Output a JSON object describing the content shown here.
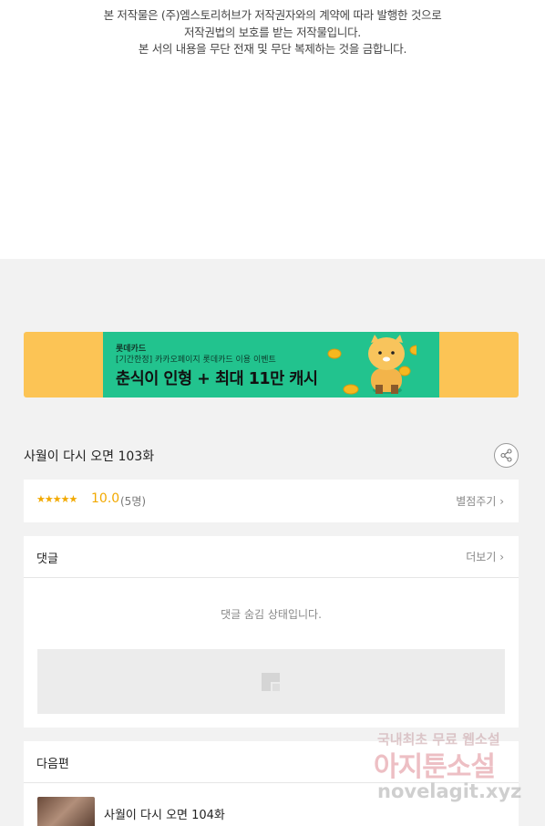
{
  "copyright": {
    "line1": "본 저작물은 (주)엠스토리허브가 저작권자와의 계약에 따라 발행한 것으로",
    "line2": "저작권법의 보호를 받는 저작물입니다.",
    "line3": "본 서의 내용을 무단 전재 및 무단 복제하는 것을 금합니다."
  },
  "banner": {
    "brand": "롯데카드",
    "subtitle": "[기간한정] 카카오페이지 롯데카드 이용 이벤트",
    "headline": "춘식이 인형 + 최대 11만 캐시",
    "colors": {
      "outer": "#fcc455",
      "inner": "#22c38e"
    }
  },
  "episode": {
    "title": "사월이 다시 오면 103화",
    "share_icon": "share-icon"
  },
  "rating": {
    "stars": "★★★★★",
    "score": "10.0",
    "count": "(5명)",
    "rate_link": "별점주기 ›"
  },
  "comments": {
    "label": "댓글",
    "more": "더보기 ›",
    "hidden_message": "댓글 숨김 상태입니다."
  },
  "next": {
    "label": "다음편",
    "title": "사월이 다시 오면 104화"
  },
  "watermark": {
    "line1": "국내최초 무료 웹소설",
    "line2": "아지툰소설",
    "line3": "novelagit.xyz"
  }
}
